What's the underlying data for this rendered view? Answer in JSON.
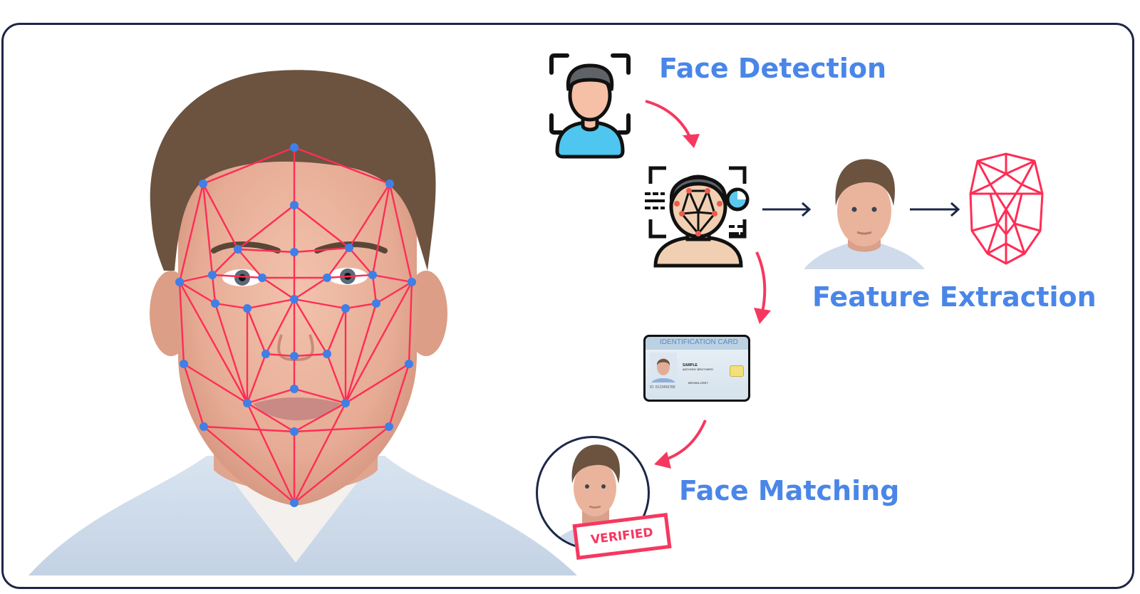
{
  "steps": {
    "detection": {
      "label": "Face Detection",
      "icon": "face-detection-icon"
    },
    "extraction": {
      "label": "Feature Extraction",
      "icon": "face-mesh-icon"
    },
    "matching": {
      "label": "Face Matching",
      "icon": "verified-portrait-icon"
    }
  },
  "id_card": {
    "title": "IDENTIFICATION CARD",
    "id_number": "ID: 0123456789",
    "name_line1": "SAMPLE",
    "name_line2": "ANTHONY BROTHERS",
    "eyes": "BROWN-GREY"
  },
  "stamp": {
    "label": "VERIFIED"
  },
  "colors": {
    "accent_blue": "#4a86e8",
    "mesh_red": "#ff2d55",
    "arrow_red": "#f5385f",
    "dark_navy": "#1c2748",
    "landmark_blue": "#3f7fe6"
  }
}
